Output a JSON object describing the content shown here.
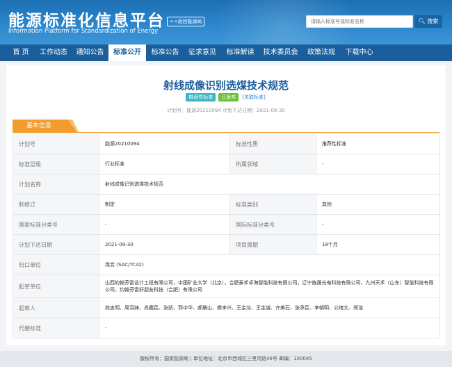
{
  "header": {
    "title": "能源标准化信息平台",
    "subtitle": "Information Platform for Standardization of Energy",
    "back_label": "<<返回能源局",
    "search_placeholder": "请输入标准号或标准名称",
    "search_button": "搜索",
    "search_icon": "magnifier-icon"
  },
  "nav": [
    {
      "label": "首 页"
    },
    {
      "label": "工作动态"
    },
    {
      "label": "通知公告"
    },
    {
      "label": "标准公开",
      "active": true
    },
    {
      "label": "标准公告"
    },
    {
      "label": "征求意见"
    },
    {
      "label": "标准解读"
    },
    {
      "label": "技术委员会"
    },
    {
      "label": "政策法规"
    },
    {
      "label": "下载中心"
    }
  ],
  "page": {
    "title": "射线成像识别选煤技术规范",
    "badges": {
      "recommended": "推荐性标准",
      "published": "已发布",
      "related": "[关联标准]"
    },
    "meta": "计划号：能源20210094   计划下达日期：2021-09-30"
  },
  "section": {
    "title": "基本信息"
  },
  "table": {
    "plan_no": {
      "label": "计划号",
      "value": "能源20210094"
    },
    "std_nature": {
      "label": "标准性质",
      "value": "推荐性标准"
    },
    "std_level": {
      "label": "标准层级",
      "value": "行业标准"
    },
    "field": {
      "label": "所属领域",
      "value": "-"
    },
    "plan_name": {
      "label": "计划名称",
      "value": "射线成像识别选煤技术规范"
    },
    "revision": {
      "label": "制修订",
      "value": "制定"
    },
    "category": {
      "label": "标准类别",
      "value": "其他"
    },
    "ccs": {
      "label": "国家标准分类号",
      "value": "-"
    },
    "ics": {
      "label": "国际标准分类号",
      "value": "-"
    },
    "issue_date": {
      "label": "计划下达日期",
      "value": "2021-09-30"
    },
    "period": {
      "label": "项目周期",
      "value": "18个月"
    },
    "owner": {
      "label": "归口单位",
      "value": "煤炭 (SAC/TC42)"
    },
    "drafting_units": {
      "label": "起草单位",
      "value": "山西約翰芬雷设计工程有限公司，中国矿业大学（北京），合肥泰禾卓海智能科技有限公司，辽宁旌晟光电科技有限公司，九州天禾（山东）智能科技有限公司，约翰芬雷好朋友科技（合肥）有限公司"
    },
    "drafters": {
      "label": "起草人",
      "value": "苑忠明、周羽妹、尚蠢民、张凯、郭中华、郝晨山、樊李兴、王金龙、王金诚、齐美石、张承臣、李朝明、公绪文、郑浩"
    },
    "replaced": {
      "label": "代替标准",
      "value": "-"
    }
  },
  "footer": {
    "text": "版权所有：国家能源局 | 单位地址：北京市西城区三里河路46号 邮编：100045"
  },
  "colors": {
    "header_blue": "#2b86cc",
    "nav_blue": "#1a5f9c",
    "tab_orange": "#f39c2d",
    "badge_teal": "#3ab3c6",
    "badge_green": "#67c23a"
  }
}
